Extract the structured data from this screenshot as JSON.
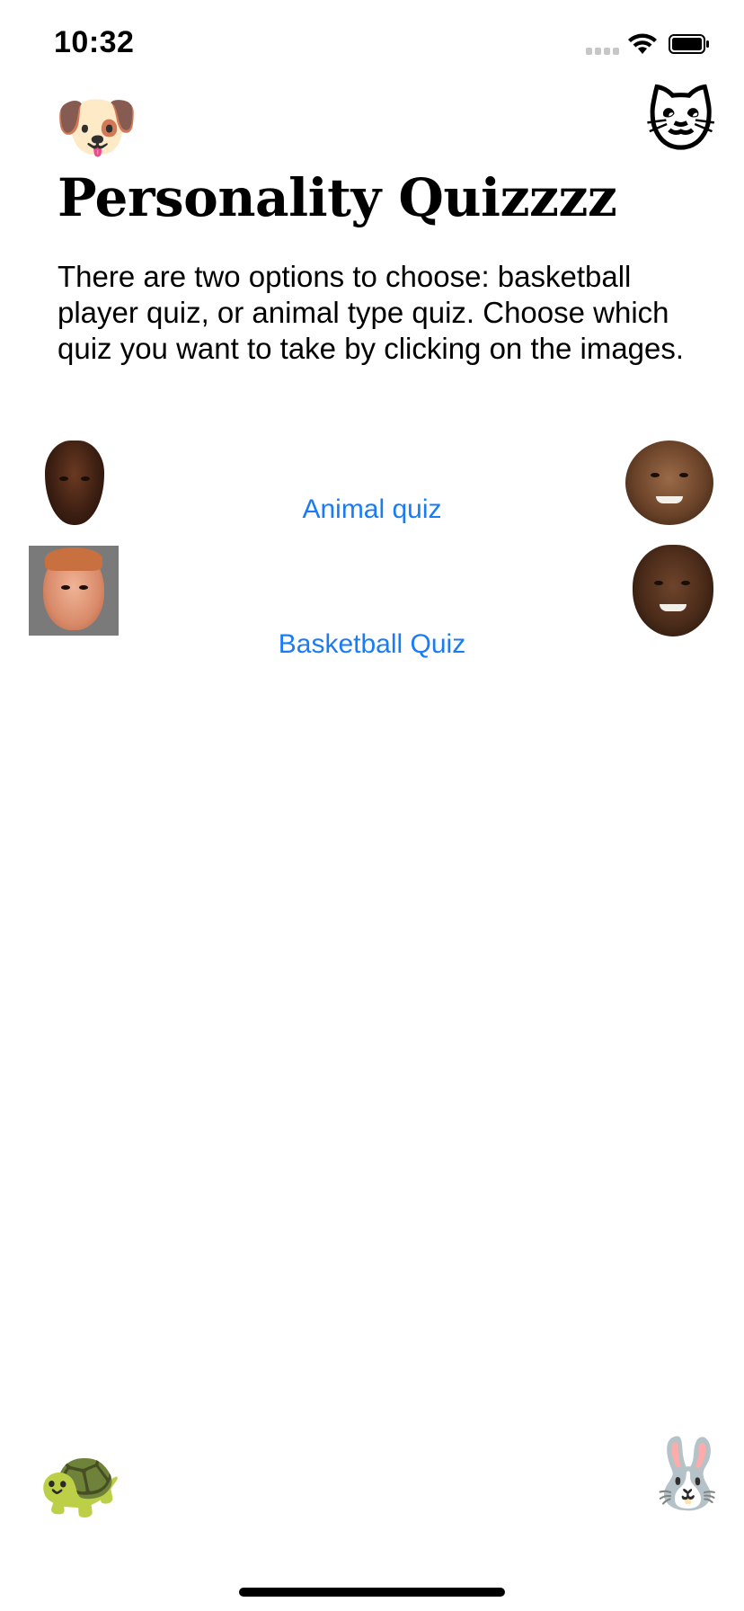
{
  "status_bar": {
    "time": "10:32",
    "icons": [
      "signal-dots-icon",
      "wifi-icon",
      "battery-icon"
    ]
  },
  "header": {
    "title": "Personality Quizzzz",
    "description": "There are two options to choose: basketball player quiz, or animal type quiz. Choose which quiz you want to take by clicking on the images."
  },
  "emojis": {
    "dog": "🐶",
    "cat": "🐱",
    "turtle": "🐢",
    "rabbit": "🐰"
  },
  "links": {
    "animal_quiz": "Animal quiz",
    "basketball_quiz": "Basketball Quiz"
  },
  "colors": {
    "link": "#1a7cf5",
    "background": "#ffffff",
    "text": "#000000"
  }
}
